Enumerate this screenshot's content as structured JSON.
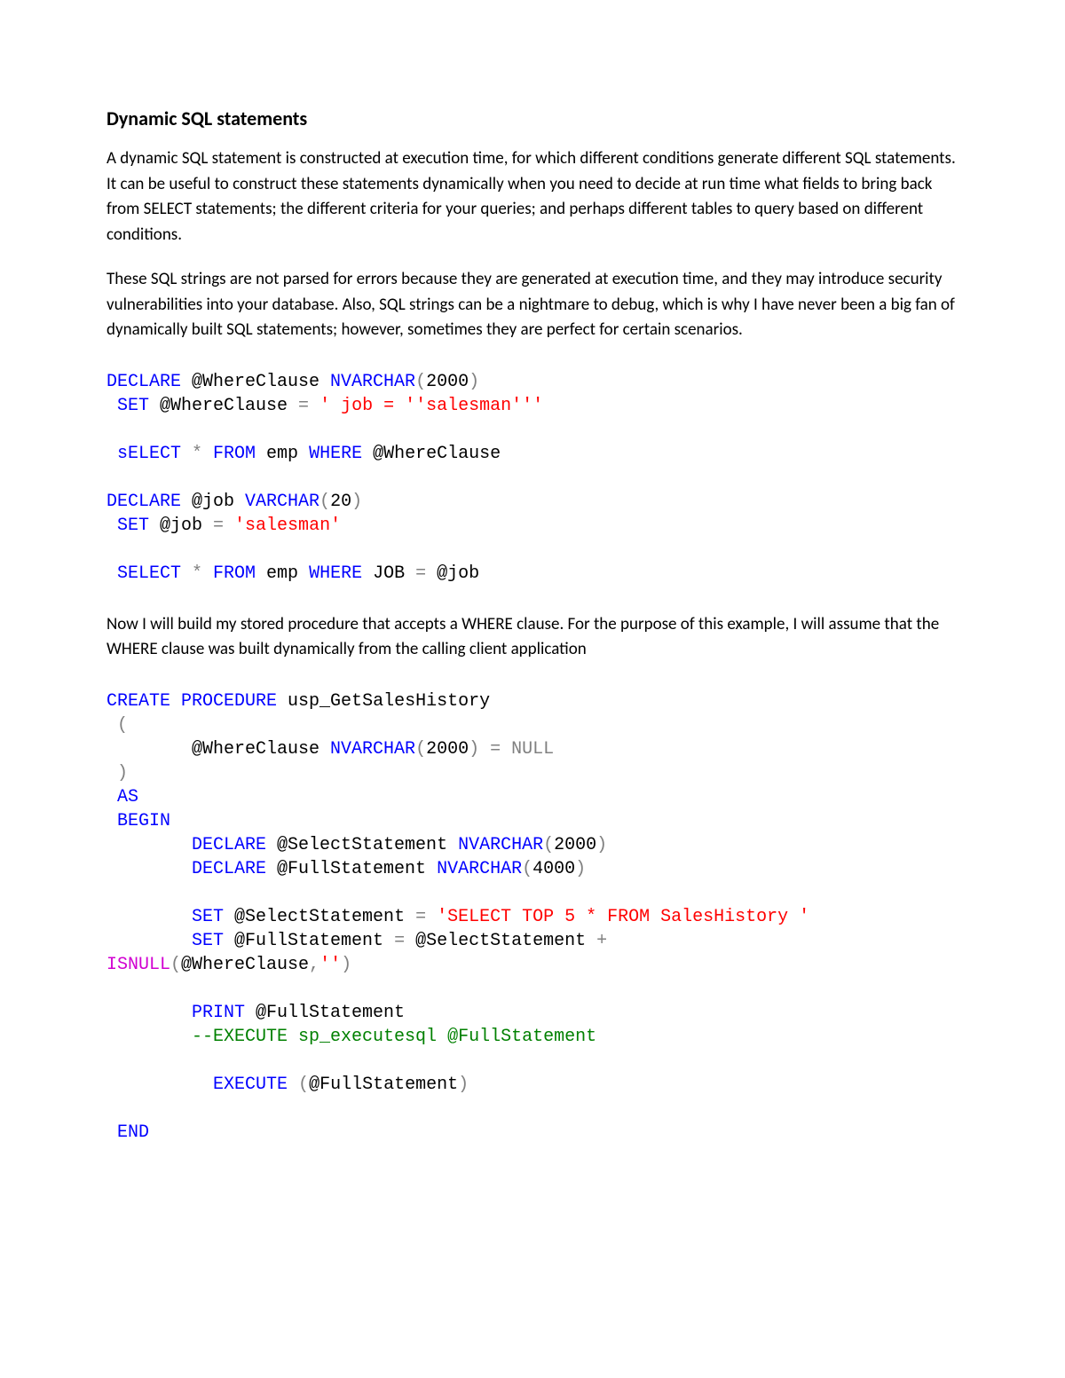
{
  "title": "Dynamic SQL statements",
  "para1": "A dynamic SQL statement is constructed at execution time, for which different conditions generate different SQL statements. It can be useful to construct these statements dynamically when you need to decide at run time what fields to bring back from SELECT statements; the different criteria for your queries; and perhaps different tables to query based on different conditions.",
  "para2": "These SQL strings are not parsed for errors because they are generated at execution time, and they may introduce security vulnerabilities into your database. Also, SQL strings can be a nightmare to debug, which is why I have never been a big fan of dynamically built SQL statements; however, sometimes they are perfect for certain scenarios.",
  "code1": {
    "l1a": "DECLARE",
    "l1b": " @WhereClause ",
    "l1c": "NVARCHAR",
    "l1d": "(",
    "l1e": "2000",
    "l1f": ")",
    "l2a": " SET",
    "l2b": " @WhereClause ",
    "l2c": "=",
    "l2d": " ' job = ''salesman'''",
    "l3a": " sELECT ",
    "l3b": "*",
    "l3c": " FROM",
    "l3d": " emp ",
    "l3e": "WHERE",
    "l3f": " @WhereClause",
    "l4a": "DECLARE",
    "l4b": " @job ",
    "l4c": "VARCHAR",
    "l4d": "(",
    "l4e": "20",
    "l4f": ")",
    "l5a": " SET",
    "l5b": " @job ",
    "l5c": "=",
    "l5d": " 'salesman'",
    "l6a": " SELECT ",
    "l6b": "*",
    "l6c": " FROM",
    "l6d": " emp ",
    "l6e": "WHERE",
    "l6f": " JOB ",
    "l6g": "=",
    "l6h": " @job"
  },
  "para3": "Now I will build my stored procedure that accepts a WHERE clause. For the purpose of this example, I will assume that the WHERE clause was built dynamically from the calling client application",
  "code2": {
    "l1a": "CREATE",
    "l1b": " PROCEDURE",
    "l1c": " usp_GetSalesHistory",
    "l2a": " (",
    "l3a": "        @WhereClause ",
    "l3b": "NVARCHAR",
    "l3c": "(",
    "l3d": "2000",
    "l3e": ")",
    "l3f": " =",
    "l3g": " NULL",
    "l4a": " )",
    "l5a": " AS",
    "l6a": " BEGIN",
    "l7a": "        DECLARE",
    "l7b": " @SelectStatement ",
    "l7c": "NVARCHAR",
    "l7d": "(",
    "l7e": "2000",
    "l7f": ")",
    "l8a": "        DECLARE",
    "l8b": " @FullStatement ",
    "l8c": "NVARCHAR",
    "l8d": "(",
    "l8e": "4000",
    "l8f": ")",
    "l9a": "        SET",
    "l9b": " @SelectStatement ",
    "l9c": "=",
    "l9d": " 'SELECT TOP 5 * FROM SalesHistory '",
    "l10a": "        SET",
    "l10b": " @FullStatement ",
    "l10c": "=",
    "l10d": " @SelectStatement ",
    "l10e": "+",
    "l11a": "ISNULL",
    "l11b": "(",
    "l11c": "@WhereClause",
    "l11d": ",",
    "l11e": "''",
    "l11f": ")",
    "l12a": "        PRINT",
    "l12b": " @FullStatement",
    "l13a": "        --EXECUTE sp_executesql @FullStatement",
    "l14a": "          EXECUTE ",
    "l14b": "(",
    "l14c": "@FullStatement",
    "l14d": ")",
    "l15a": " END"
  }
}
